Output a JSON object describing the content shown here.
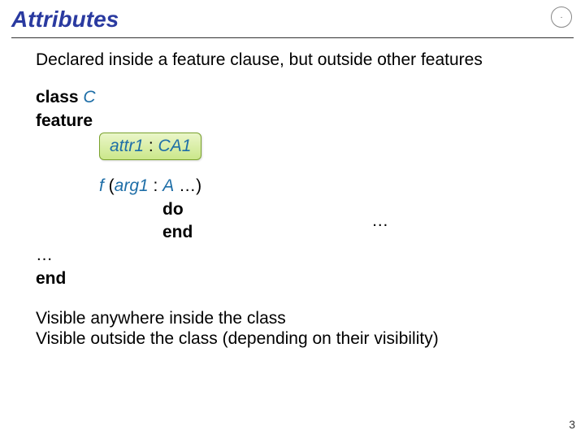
{
  "title": "Attributes",
  "logo_glyph": "·",
  "lead": "Declared inside a feature clause, but outside other features",
  "code": {
    "class_kw": "class",
    "class_name": "C",
    "feature_kw": "feature",
    "attr_decl_name": "attr1",
    "attr_decl_colon": " : ",
    "attr_decl_type": "CA1",
    "fn_name": "f",
    "fn_sig_open": "  (",
    "fn_arg_name": "arg1",
    "fn_arg_colon": " : ",
    "fn_arg_type": "A",
    "fn_sig_rest": " …)",
    "do_kw": "do",
    "body_ellipsis": "…",
    "end_kw_inner": "end",
    "mid_ellipsis": "…",
    "end_kw_outer": "end"
  },
  "para1": "Visible anywhere inside the class",
  "para2": "Visible outside the class (depending on their visibility)",
  "page_number": "3"
}
